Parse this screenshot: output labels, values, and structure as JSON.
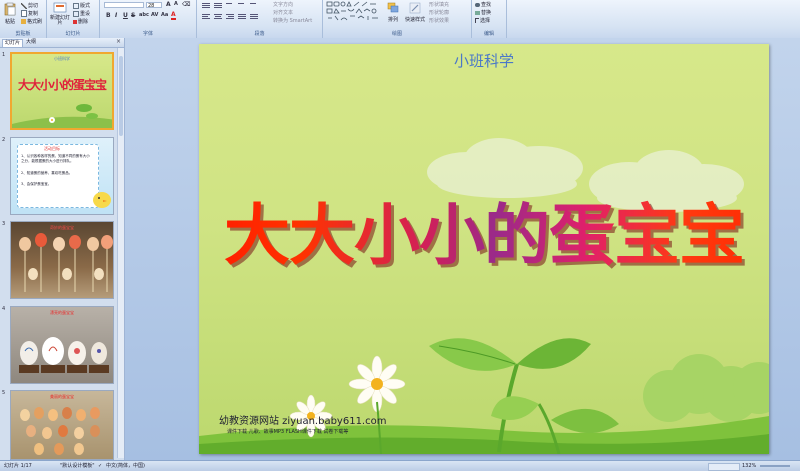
{
  "ribbon": {
    "groups": [
      {
        "label": "剪贴板",
        "buttons": [
          "粘贴",
          "剪切",
          "复制",
          "格式刷"
        ]
      },
      {
        "label": "幻灯片",
        "buttons": [
          "新建幻灯片",
          "版式",
          "重设",
          "删除"
        ]
      },
      {
        "label": "字体",
        "font_size": "28",
        "format_buttons": [
          "B",
          "I",
          "U",
          "S",
          "abc",
          "AV",
          "Aa",
          "A"
        ]
      },
      {
        "label": "段落",
        "buttons": [
          "文字方向",
          "对齐文本",
          "转换为 SmartArt"
        ]
      },
      {
        "label": "绘图",
        "buttons": [
          "排列",
          "快速样式",
          "形状填充",
          "形状轮廓",
          "形状效果"
        ]
      },
      {
        "label": "编辑",
        "buttons": [
          "查找",
          "替换",
          "选择"
        ]
      }
    ]
  },
  "leftpane": {
    "tabs": [
      "幻灯片",
      "大纲"
    ],
    "close": "×",
    "thumbs": [
      {
        "num": "1",
        "title": "大大小小的蛋宝宝",
        "subtitle": "小班科学"
      },
      {
        "num": "2",
        "title": "活动目标",
        "items": [
          "1、认识各种各样的蛋，知道不同的蛋有大小之分，能根据蛋的大小进行排队。",
          "2、知道蛋的营养，喜欢吃蛋品。",
          "3、会保护蛋宝宝。"
        ]
      },
      {
        "num": "3",
        "title": "奇妙的蛋宝宝"
      },
      {
        "num": "4",
        "title": "漂亮的蛋宝宝"
      },
      {
        "num": "5",
        "title": "美丽的蛋宝宝"
      }
    ]
  },
  "slide": {
    "subtitle": "小班科学",
    "title": "大大小小的蛋宝宝",
    "footer_site": "幼教资源网站  ziyuan.baby611.com",
    "footer_links": "课件下载  儿歌、故事MP3  FLASH课件下载  试卷下载等"
  },
  "status": {
    "slide_info": "幻灯片 1/17",
    "theme": "\"默认设计模板\"",
    "language": "中文(简体，中国)",
    "zoom": "132%"
  },
  "colors": {
    "ribbon_bg": "#dbe6f4",
    "slide_bg": "#cfe383",
    "subtitle": "#4a78c8",
    "title_red": "#ff2200",
    "title_purple": "#9a2a8a",
    "accent_selection": "#f0a830"
  }
}
